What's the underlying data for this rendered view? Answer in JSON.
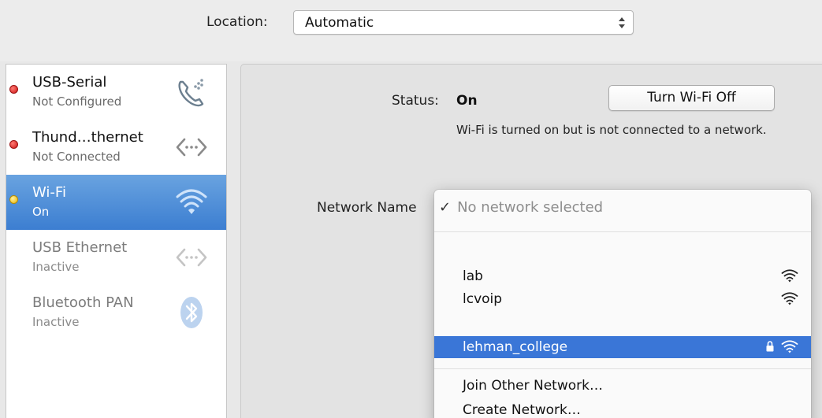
{
  "location": {
    "label": "Location:",
    "value": "Automatic"
  },
  "sidebar": {
    "items": [
      {
        "name": "USB-Serial",
        "status": "Not Configured",
        "icon": "phone-icon",
        "dot": "red"
      },
      {
        "name": "Thund…thernet",
        "status": "Not Connected",
        "icon": "ethernet-icon",
        "dot": "red"
      },
      {
        "name": "Wi-Fi",
        "status": "On",
        "icon": "wifi-icon",
        "dot": "yellow",
        "selected": true
      },
      {
        "name": "USB Ethernet",
        "status": "Inactive",
        "icon": "ethernet-icon"
      },
      {
        "name": "Bluetooth PAN",
        "status": "Inactive",
        "icon": "bluetooth-icon"
      }
    ]
  },
  "status": {
    "label": "Status:",
    "value": "On",
    "button": "Turn Wi-Fi Off",
    "description": "Wi-Fi is turned on but is not connected to a network."
  },
  "network": {
    "label": "Network Name",
    "current": "No network selected",
    "check": "✓",
    "networks": [
      {
        "name": "lab",
        "secure": false
      },
      {
        "name": "lcvoip",
        "secure": false
      },
      {
        "name": "lehman_college",
        "secure": true,
        "highlighted": true
      }
    ],
    "actions": [
      "Join Other Network…",
      "Create Network…"
    ]
  },
  "colors": {
    "selection": "#3a76d7",
    "sidebar_selected": "#4f8fd9",
    "status_red": "#cc1515",
    "status_yellow": "#eab300"
  }
}
